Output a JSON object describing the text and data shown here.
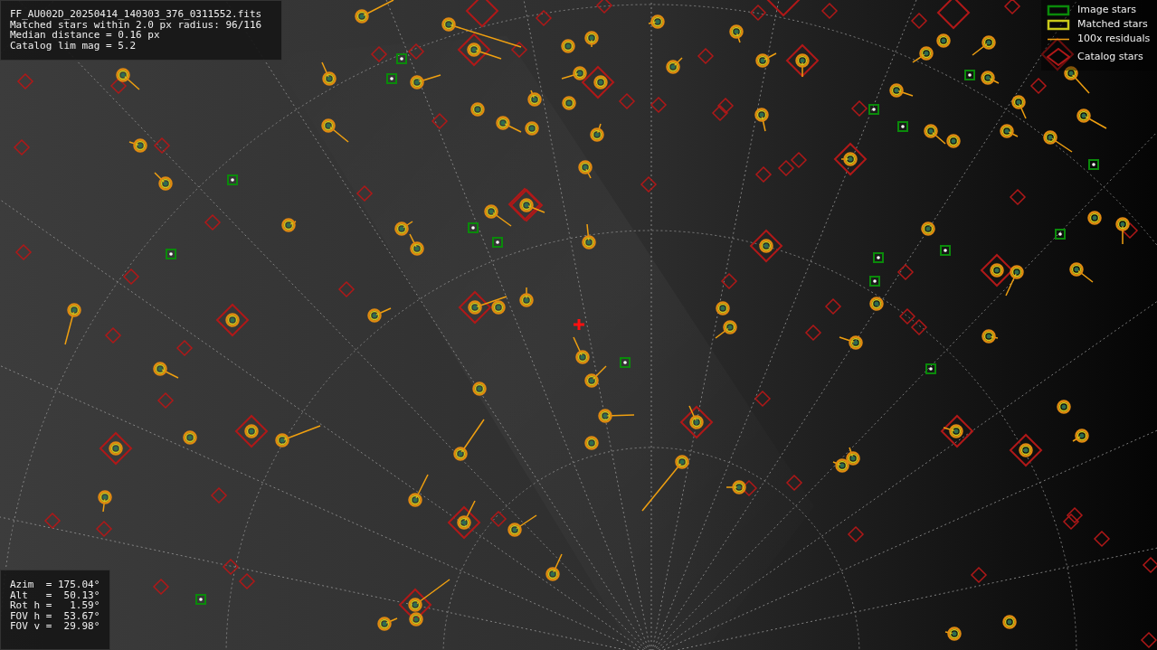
{
  "info_box": {
    "lines": [
      "FF_AU002D_20250414_140303_376_0311552.fits",
      "Matched stars within 2.0 px radius: 96/116",
      "Median distance = 0.16 px",
      "Catalog lim mag = 5.2"
    ]
  },
  "legend": [
    {
      "kind": "image",
      "label": "Image stars"
    },
    {
      "kind": "matched",
      "label": "Matched stars"
    },
    {
      "kind": "residual",
      "label": "100x residuals"
    },
    {
      "kind": "catalog",
      "label": "Catalog stars"
    }
  ],
  "pointing_box": {
    "lines": [
      "Azim  = 175.04°",
      "Alt   =  50.13°",
      "Rot h =   1.59°",
      "FOV h =  53.67°",
      "FOV v =  29.98°"
    ]
  }
}
